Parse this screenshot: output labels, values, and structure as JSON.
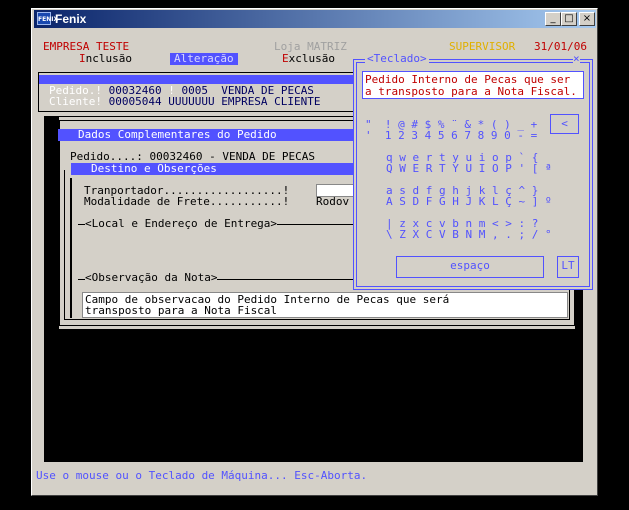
{
  "window": {
    "title": "Fenix",
    "icon_label": "FENIX",
    "minimize": "_",
    "maximize": "□",
    "close": "×"
  },
  "header": {
    "company": "EMPRESA TESTE",
    "store": "Loja MATRIZ",
    "user": "SUPERVISOR",
    "date": "31/01/06"
  },
  "menu": {
    "inclusao_hot": "I",
    "inclusao_rest": "nclusão",
    "alteracao": "Alteração",
    "exclusao_hot": "E",
    "exclusao_rest": "xclusão"
  },
  "order_info": {
    "pedido_label": "Pedido.!",
    "pedido_num": "00032460",
    "sep1": "!",
    "tipo_code": "0005",
    "tipo_desc": "VENDA DE PECAS",
    "cliente_label": "Cliente!",
    "cliente_code": "00005044",
    "cliente_desc": "UUUUUUU EMPRESA CLIENTE"
  },
  "complementares": {
    "title": "Dados Complementares do Pedido",
    "pedido_line_label": "Pedido....:",
    "pedido_line_value": "00032460 - VENDA DE PECAS",
    "destino_title": "Destino e Obserções",
    "transportador_label": "Tranportador..................!",
    "modalidade_label": "Modalidade de Frete...........!",
    "modalidade_value": "Rodov",
    "local_title": "<Local e Endereço de Entrega>",
    "obs_title": "<Observação da Nota>",
    "obs_text_1": "Campo de observacao do Pedido Interno de Pecas que será",
    "obs_text_2": "transposto para a Nota Fiscal"
  },
  "keyboard": {
    "title": "<Teclado>",
    "close": "×",
    "preview_1": "Pedido Interno de Pecas que ser",
    "preview_2": "a transposto para a Nota Fiscal.",
    "row1a": "\"  ! @ # $ % ¨ & * ( ) _ +",
    "row1b": "'  1 2 3 4 5 6 7 8 9 0 - =",
    "backspace": "<",
    "row2a": "q w e r t y u i o p ` {",
    "row2b": "Q W E R T Y U I O P ' [ ª",
    "row3a": "a s d f g h j k l ç ^ }",
    "row3b": "A S D F G H J K L Ç ~ ] º",
    "row4a": "| z x c v b n m < > : ?",
    "row4b": "\\ Z X C V B N M , . ; / °",
    "space": "espaço",
    "lt": "LT"
  },
  "status_bar": "Use o mouse ou o Teclado de Máquina... Esc-Aborta."
}
